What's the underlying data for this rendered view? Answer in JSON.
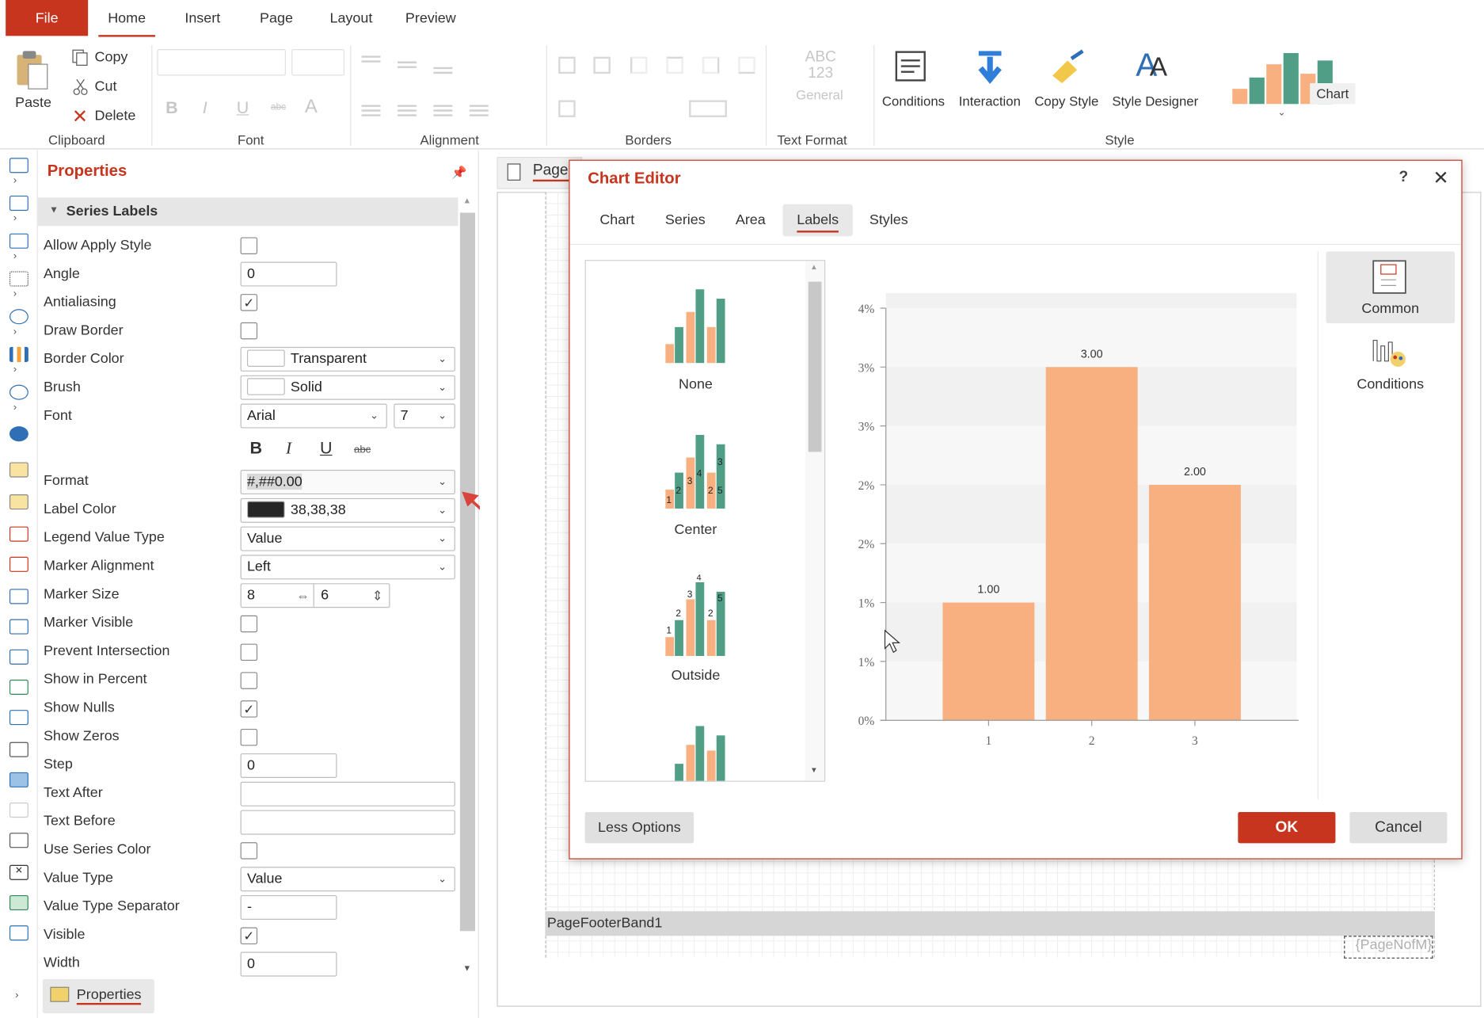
{
  "ribbon": {
    "tabs": [
      "File",
      "Home",
      "Insert",
      "Page",
      "Layout",
      "Preview"
    ],
    "clipboard": {
      "paste": "Paste",
      "copy": "Copy",
      "cut": "Cut",
      "delete": "Delete",
      "label": "Clipboard"
    },
    "font_label": "Font",
    "alignment_label": "Alignment",
    "borders_label": "Borders",
    "text_format": {
      "abc": "ABC",
      "num": "123",
      "general": "General",
      "label": "Text Format"
    },
    "style": {
      "conditions": "Conditions",
      "interaction": "Interaction",
      "copy_style": "Copy Style",
      "style_designer": "Style Designer",
      "chart": "Chart",
      "label": "Style"
    }
  },
  "properties": {
    "title": "Properties",
    "section": "Series Labels",
    "tab_label": "Properties",
    "rows": {
      "allow_apply_style": {
        "label": "Allow Apply Style",
        "checked": false
      },
      "angle": {
        "label": "Angle",
        "value": "0"
      },
      "antialiasing": {
        "label": "Antialiasing",
        "checked": true
      },
      "draw_border": {
        "label": "Draw Border",
        "checked": false
      },
      "border_color": {
        "label": "Border Color",
        "value": "Transparent"
      },
      "brush": {
        "label": "Brush",
        "value": "Solid"
      },
      "font": {
        "label": "Font",
        "family": "Arial",
        "size": "7",
        "bold": "B",
        "italic": "I",
        "underline": "U",
        "strike": "abc"
      },
      "format": {
        "label": "Format",
        "value": "#,##0.00"
      },
      "label_color": {
        "label": "Label Color",
        "value": "38,38,38",
        "swatch": "#262626"
      },
      "legend_value_type": {
        "label": "Legend Value Type",
        "value": "Value"
      },
      "marker_alignment": {
        "label": "Marker Alignment",
        "value": "Left"
      },
      "marker_size": {
        "label": "Marker Size",
        "width": "8",
        "height": "6"
      },
      "marker_visible": {
        "label": "Marker Visible",
        "checked": false
      },
      "prevent_intersection": {
        "label": "Prevent Intersection",
        "checked": false
      },
      "show_in_percent": {
        "label": "Show in Percent",
        "checked": false
      },
      "show_nulls": {
        "label": "Show Nulls",
        "checked": true
      },
      "show_zeros": {
        "label": "Show Zeros",
        "checked": false
      },
      "step": {
        "label": "Step",
        "value": "0"
      },
      "text_after": {
        "label": "Text After",
        "value": ""
      },
      "text_before": {
        "label": "Text Before",
        "value": ""
      },
      "use_series_color": {
        "label": "Use Series Color",
        "checked": false
      },
      "value_type": {
        "label": "Value Type",
        "value": "Value"
      },
      "value_type_separator": {
        "label": "Value Type Separator",
        "value": "-"
      },
      "visible": {
        "label": "Visible",
        "checked": true
      },
      "width": {
        "label": "Width",
        "value": "0"
      }
    }
  },
  "design": {
    "page_tab": "Page1",
    "footer_band": "PageFooterBand1",
    "page_n_of_m": "{PageNofM}"
  },
  "dialog": {
    "title": "Chart Editor",
    "help": "?",
    "close": "✕",
    "tabs": [
      "Chart",
      "Series",
      "Area",
      "Labels",
      "Styles"
    ],
    "positions": [
      "None",
      "Center",
      "Outside"
    ],
    "side": {
      "common": "Common",
      "conditions": "Conditions"
    },
    "less_options": "Less Options",
    "ok": "OK",
    "cancel": "Cancel"
  },
  "colors": {
    "accent": "#c7351e",
    "orange": "#f9b081",
    "teal": "#4f9e85"
  },
  "chart_data": {
    "type": "bar",
    "categories": [
      "1",
      "2",
      "3"
    ],
    "values": [
      1.0,
      3.0,
      2.0
    ],
    "data_labels": [
      "1.00",
      "3.00",
      "2.00"
    ],
    "y_tick_labels": [
      "0%",
      "1%",
      "1%",
      "2%",
      "2%",
      "3%",
      "3%",
      "4%"
    ],
    "ylim": [
      0,
      3.5
    ],
    "grid": true,
    "color": "#f9b081"
  }
}
